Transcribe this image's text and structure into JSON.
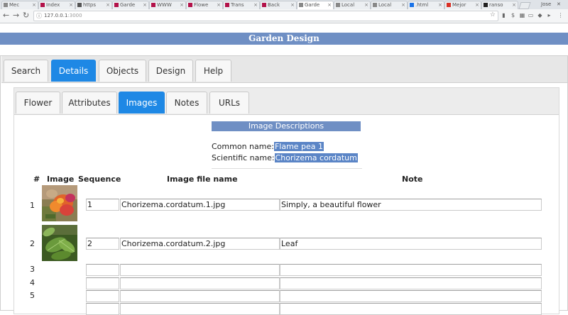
{
  "browser": {
    "tabs": [
      {
        "title": "Mec",
        "favicon_color": "#8a8a8a"
      },
      {
        "title": "Index",
        "favicon_color": "#b3134a"
      },
      {
        "title": "https",
        "favicon_color": "#555555"
      },
      {
        "title": "Garde",
        "favicon_color": "#b3134a"
      },
      {
        "title": "WWW",
        "favicon_color": "#b3134a"
      },
      {
        "title": "Flowe",
        "favicon_color": "#b3134a"
      },
      {
        "title": "Trans",
        "favicon_color": "#b3134a"
      },
      {
        "title": "Back",
        "favicon_color": "#b3134a"
      },
      {
        "title": "Garde",
        "favicon_color": "#888888",
        "active": true
      },
      {
        "title": "Local",
        "favicon_color": "#888888"
      },
      {
        "title": "Local",
        "favicon_color": "#888888"
      },
      {
        "title": ".html",
        "favicon_color": "#1a73e8"
      },
      {
        "title": "Mejor",
        "favicon_color": "#d93025"
      },
      {
        "title": "ranso",
        "favicon_color": "#222222"
      }
    ],
    "window_label": "Jose",
    "url_host": "127.0.0.1",
    "url_port": ":3000"
  },
  "app": {
    "title": "Garden Design"
  },
  "main_tabs": [
    {
      "label": "Search"
    },
    {
      "label": "Details",
      "active": true
    },
    {
      "label": "Objects"
    },
    {
      "label": "Design"
    },
    {
      "label": "Help"
    }
  ],
  "sub_tabs": [
    {
      "label": "Flower"
    },
    {
      "label": "Attributes"
    },
    {
      "label": "Images",
      "active": true
    },
    {
      "label": "Notes"
    },
    {
      "label": "URLs"
    }
  ],
  "section": {
    "title": "Image Descriptions",
    "common_label": "Common name:",
    "common_value": "Flame pea 1",
    "scientific_label": "Scientific name:",
    "scientific_value": "Chorizema cordatum"
  },
  "table": {
    "headers": {
      "num": "#",
      "image": "Image",
      "sequence": "Sequence",
      "file": "Image file name",
      "note": "Note"
    },
    "rows": [
      {
        "num": "1",
        "sequence": "1",
        "file": "Chorizema.cordatum.1.jpg",
        "note": "Simply, a beautiful flower",
        "thumb": "flower"
      },
      {
        "num": "2",
        "sequence": "2",
        "file": "Chorizema.cordatum.2.jpg",
        "note": "Leaf",
        "thumb": "leaf"
      },
      {
        "num": "3",
        "sequence": "",
        "file": "",
        "note": ""
      },
      {
        "num": "4",
        "sequence": "",
        "file": "",
        "note": ""
      },
      {
        "num": "5",
        "sequence": "",
        "file": "",
        "note": ""
      }
    ]
  },
  "colors": {
    "title_bar": "#6f8fc4",
    "active_tab": "#1e88e5",
    "selection": "#5b85c6"
  }
}
